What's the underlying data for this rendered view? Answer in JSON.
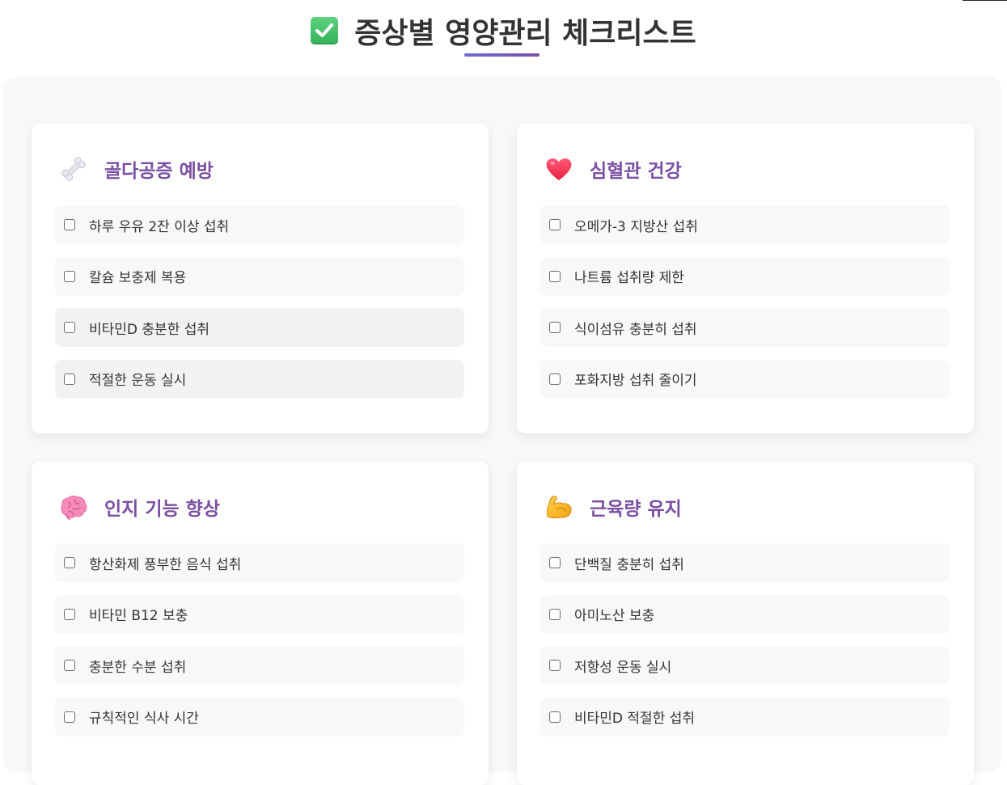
{
  "page": {
    "title": "증상별 영양관리 체크리스트",
    "title_icon": "white-check-mark-icon",
    "accent_color": "#7a4fa3"
  },
  "cards": [
    {
      "title": "골다공증 예방",
      "icon": "bone-icon",
      "items": [
        {
          "label": "하루 우유 2잔 이상 섭취",
          "checked": false
        },
        {
          "label": "칼슘 보충제 복용",
          "checked": false
        },
        {
          "label": "비타민D 충분한 섭취",
          "checked": false
        },
        {
          "label": "적절한 운동 실시",
          "checked": false
        }
      ]
    },
    {
      "title": "심혈관 건강",
      "icon": "heart-icon",
      "items": [
        {
          "label": "오메가-3 지방산 섭취",
          "checked": false
        },
        {
          "label": "나트륨 섭취량 제한",
          "checked": false
        },
        {
          "label": "식이섬유 충분히 섭취",
          "checked": false
        },
        {
          "label": "포화지방 섭취 줄이기",
          "checked": false
        }
      ]
    },
    {
      "title": "인지 기능 향상",
      "icon": "brain-icon",
      "items": [
        {
          "label": "항산화제 풍부한 음식 섭취",
          "checked": false
        },
        {
          "label": "비타민 B12 보충",
          "checked": false
        },
        {
          "label": "충분한 수분 섭취",
          "checked": false
        },
        {
          "label": "규칙적인 식사 시간",
          "checked": false
        }
      ]
    },
    {
      "title": "근육량 유지",
      "icon": "flexed-biceps-icon",
      "items": [
        {
          "label": "단백질 충분히 섭취",
          "checked": false
        },
        {
          "label": "아미노산 보충",
          "checked": false
        },
        {
          "label": "저항성 운동 실시",
          "checked": false
        },
        {
          "label": "비타민D 적절한 섭취",
          "checked": false
        }
      ]
    }
  ]
}
